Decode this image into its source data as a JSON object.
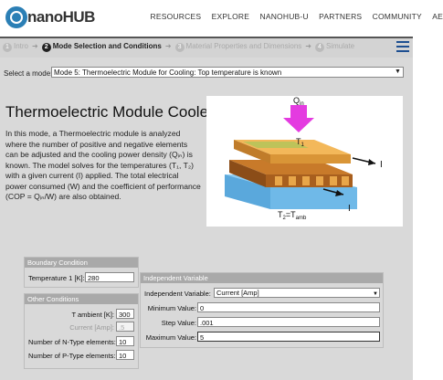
{
  "header": {
    "logo_text": "nanoHUB",
    "nav": [
      "RESOURCES",
      "EXPLORE",
      "NANOHUB-U",
      "PARTNERS",
      "COMMUNITY",
      "AE"
    ]
  },
  "steps": [
    {
      "num": "1",
      "label": "Intro"
    },
    {
      "num": "2",
      "label": "Mode Selection and Conditions"
    },
    {
      "num": "3",
      "label": "Material Properties and Dimensions"
    },
    {
      "num": "4",
      "label": "Simulate"
    }
  ],
  "mode": {
    "label": "Select a mode:",
    "value": "Mode 5: Thermoelectric Module for Cooling: Top temperature is known"
  },
  "title": "Thermoelectric Module Cooler",
  "description": "In this mode, a Thermoelectric module is analyzed where the number of positive and negative elements can be adjusted and the cooling power density (Qᵢₙ) is known. The model solves for the temperatures (T₁, T₂) with a given current (I) applied. The total electrical power consumed (W) and the coefficient of performance (COP = Qᵢₙ/W) are also obtained.",
  "diagram": {
    "q_label": "Q",
    "q_sub": "in",
    "t1": "T",
    "t1_sub": "1",
    "t2": "T",
    "t2_sub": "2",
    "t2_eq": "=T",
    "t2_eq_sub": "amb",
    "i_label": "I"
  },
  "boundary": {
    "title": "Boundary Condition",
    "temp1_label": "Temperature 1 [K]:",
    "temp1_value": "280"
  },
  "other": {
    "title": "Other Conditions",
    "t_ambient_label": "T ambient [K]:",
    "t_ambient_value": "300",
    "current_label": "Current [Amp]:",
    "current_value": ".5",
    "n_label": "Number of N-Type elements:",
    "n_value": "10",
    "p_label": "Number of P-Type elements:",
    "p_value": "10"
  },
  "independent": {
    "title": "Independent Variable",
    "var_label": "Independent Variable:",
    "var_value": "Current [Amp]",
    "min_label": "Minimum Value:",
    "min_value": "0",
    "step_label": "Step Value:",
    "step_value": ".001",
    "max_label": "Maximum Value:",
    "max_value": "5"
  },
  "colors": {
    "accent": "#1d4f91",
    "panel": "#d9d9d9",
    "group_header": "#a9a9a9"
  }
}
